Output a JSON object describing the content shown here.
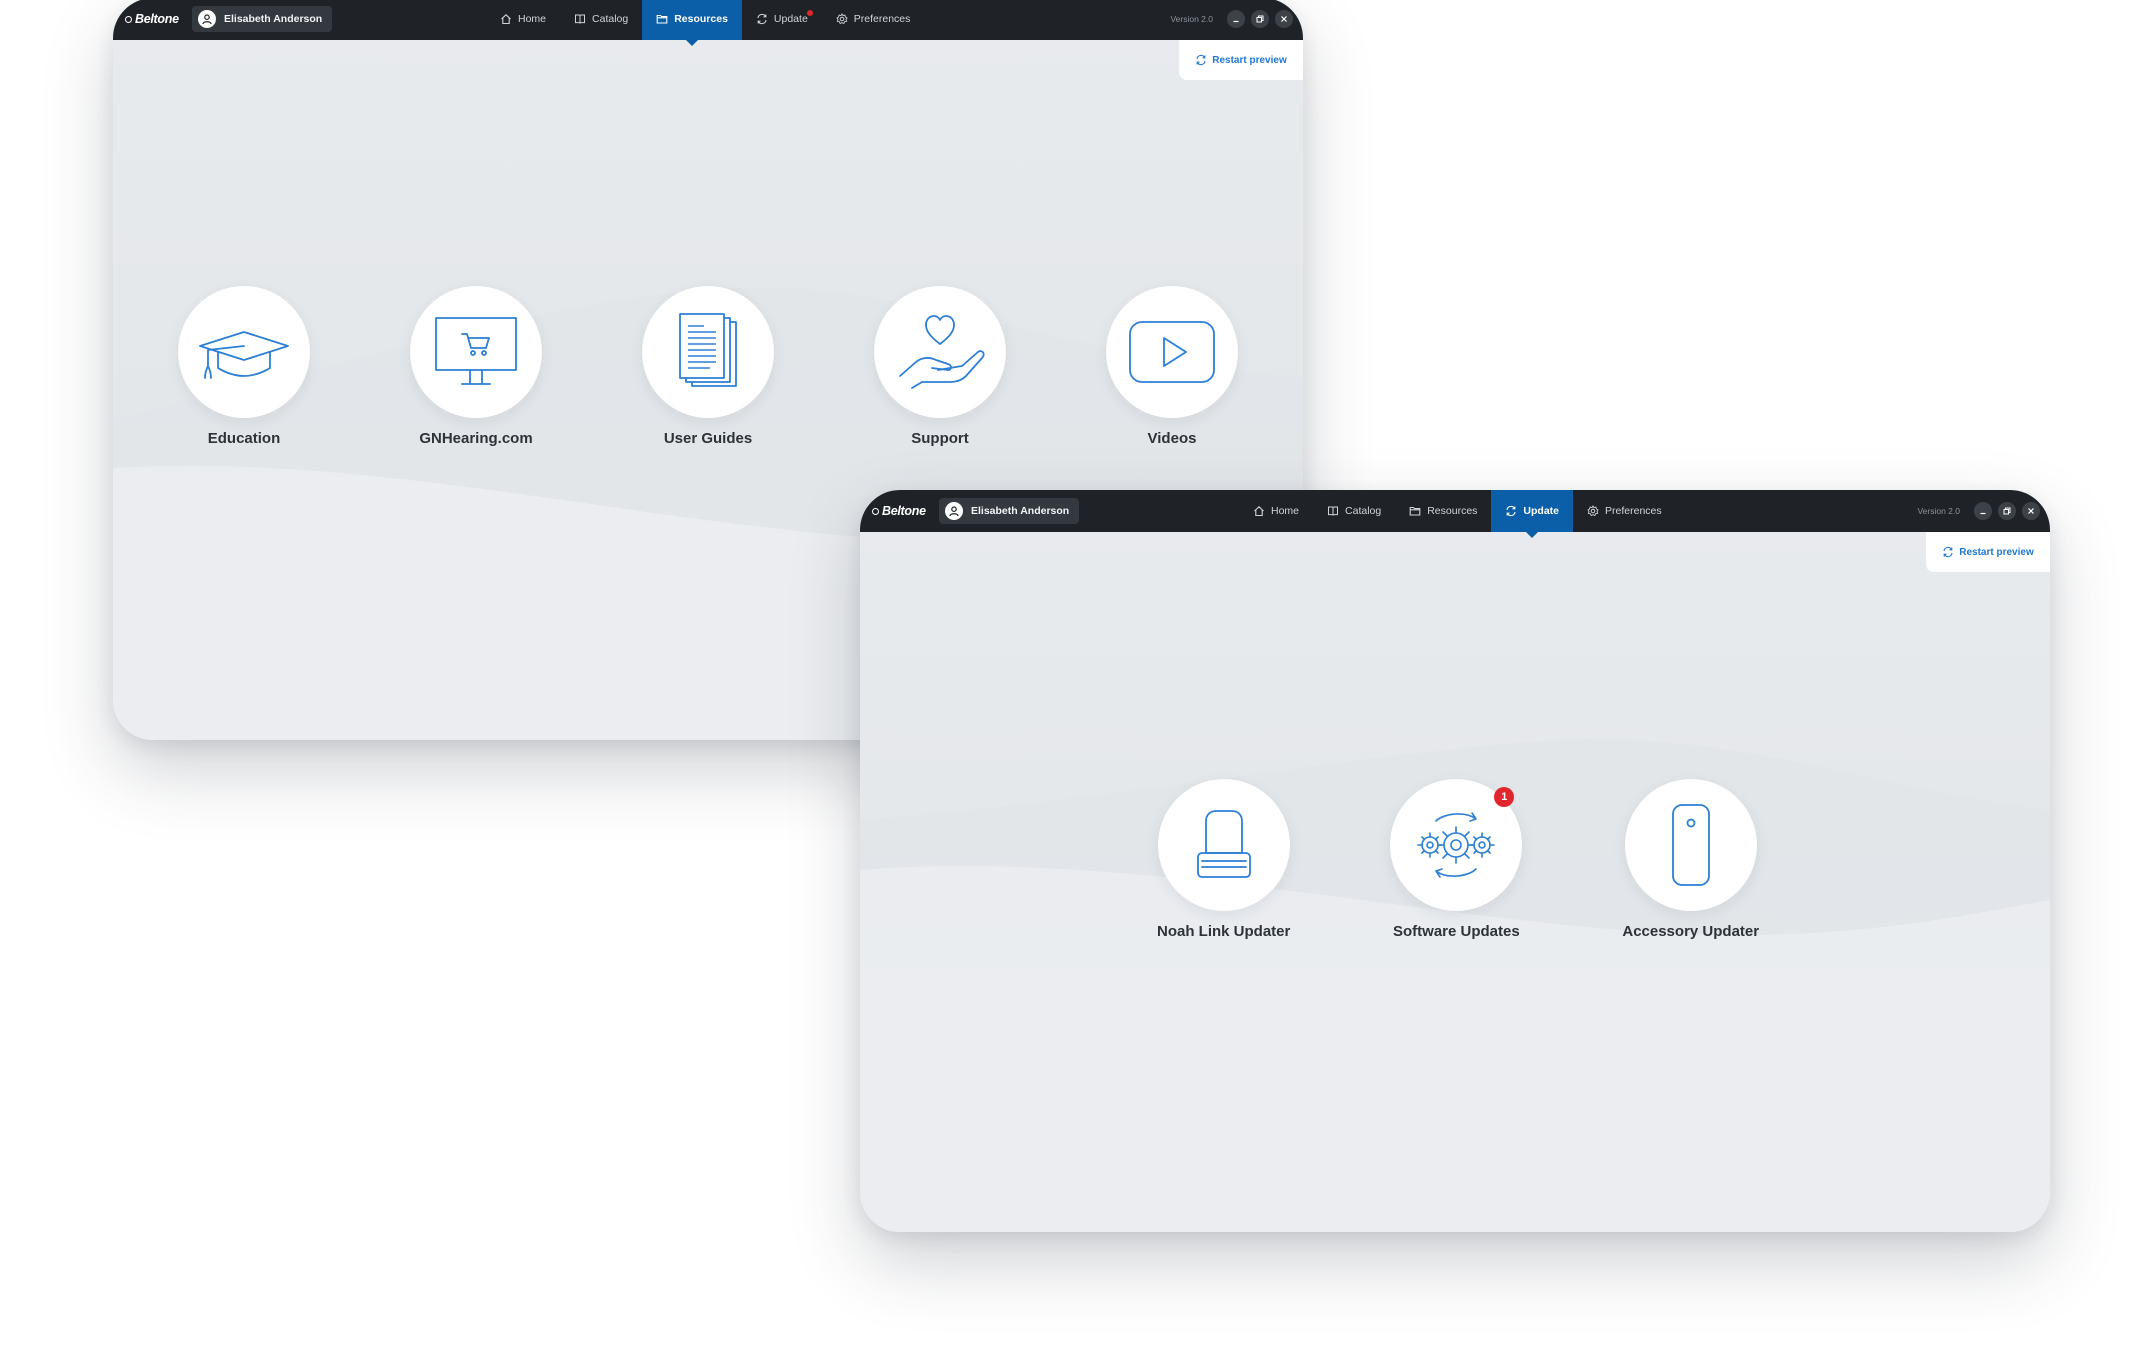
{
  "brand": "Beltone",
  "user_name": "Elisabeth Anderson",
  "nav_labels": {
    "home": "Home",
    "catalog": "Catalog",
    "resources": "Resources",
    "update": "Update",
    "preferences": "Preferences"
  },
  "version": "Version 2.0",
  "restart_label": "Restart preview",
  "resources_window": {
    "active_tab": "Resources",
    "update_notification": true,
    "tiles": [
      {
        "label": "Education",
        "icon": "graduation-cap-icon"
      },
      {
        "label": "GNHearing.com",
        "icon": "monitor-cart-icon"
      },
      {
        "label": "User Guides",
        "icon": "documents-icon"
      },
      {
        "label": "Support",
        "icon": "heart-hand-icon"
      },
      {
        "label": "Videos",
        "icon": "play-video-icon"
      }
    ]
  },
  "update_window": {
    "active_tab": "Update",
    "tiles": [
      {
        "label": "Noah Link Updater",
        "icon": "noah-link-device-icon"
      },
      {
        "label": "Software Updates",
        "icon": "gears-sync-icon",
        "badge": "1"
      },
      {
        "label": "Accessory Updater",
        "icon": "remote-control-icon"
      }
    ]
  },
  "colors": {
    "accent": "#0b5ea8",
    "icon_blue": "#2b7fd4",
    "topbar": "#1f2327",
    "badge_red": "#e1262d"
  }
}
